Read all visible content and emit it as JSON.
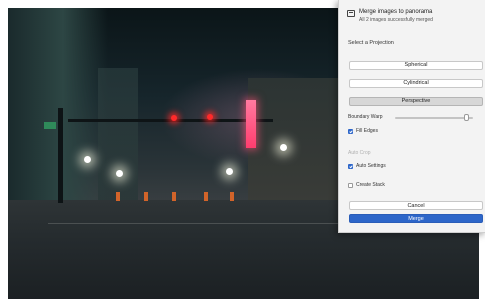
{
  "panel": {
    "title": "Merge images to panorama",
    "subtitle": "All 2 images successfully merged",
    "projection_label": "Select a Projection",
    "projections": [
      {
        "label": "Spherical",
        "selected": false
      },
      {
        "label": "Cylindrical",
        "selected": false
      },
      {
        "label": "Perspective",
        "selected": true
      }
    ],
    "boundary_warp": {
      "label": "Boundary Warp",
      "value_fraction": 0.95
    },
    "fill_edges": {
      "label": "Fill Edges",
      "checked": true
    },
    "auto_crop": {
      "label": "Auto Crop",
      "checked": false,
      "disabled": true
    },
    "auto_settings": {
      "label": "Auto Settings",
      "checked": true
    },
    "create_stack": {
      "label": "Create Stack",
      "checked": false
    },
    "cancel_label": "Cancel",
    "merge_label": "Merge"
  },
  "colors": {
    "accent": "#2d66c9",
    "traffic_light": "#ff2a2a",
    "neon": "#ff3d6e"
  },
  "icons": {
    "panel_icon": "panorama-icon"
  }
}
